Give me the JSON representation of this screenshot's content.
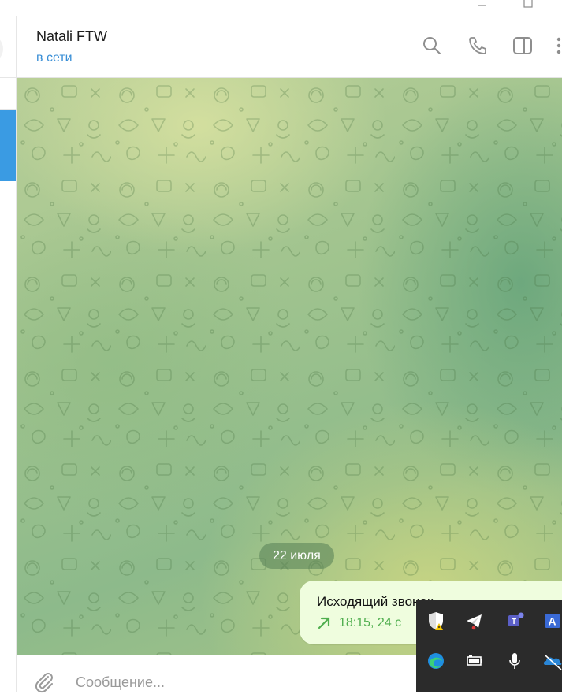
{
  "window": {
    "minimize_icon": "minimize-icon",
    "maximize_icon": "maximize-icon"
  },
  "chat": {
    "name": "Natali FTW",
    "status": "в сети"
  },
  "header_actions": [
    "search-icon",
    "phone-icon",
    "sidebar-toggle-icon",
    "more-vertical-icon"
  ],
  "date_separator": "22 июля",
  "message": {
    "title": "Исходящий звонок",
    "time": "18:15, 24 с",
    "direction_icon": "outgoing-arrow-icon",
    "accent_color": "#4fae4e"
  },
  "composer": {
    "placeholder": "Сообщение..."
  },
  "colors": {
    "accent": "#3a9be3",
    "status": "#3a8fd6",
    "bubble": "#effdde",
    "tray": "#2b2b2b"
  },
  "tray_icons": [
    "windows-security-icon",
    "telegram-icon",
    "teams-icon",
    "language-icon",
    "edge-icon",
    "battery-icon",
    "microphone-icon",
    "onedrive-icon"
  ]
}
